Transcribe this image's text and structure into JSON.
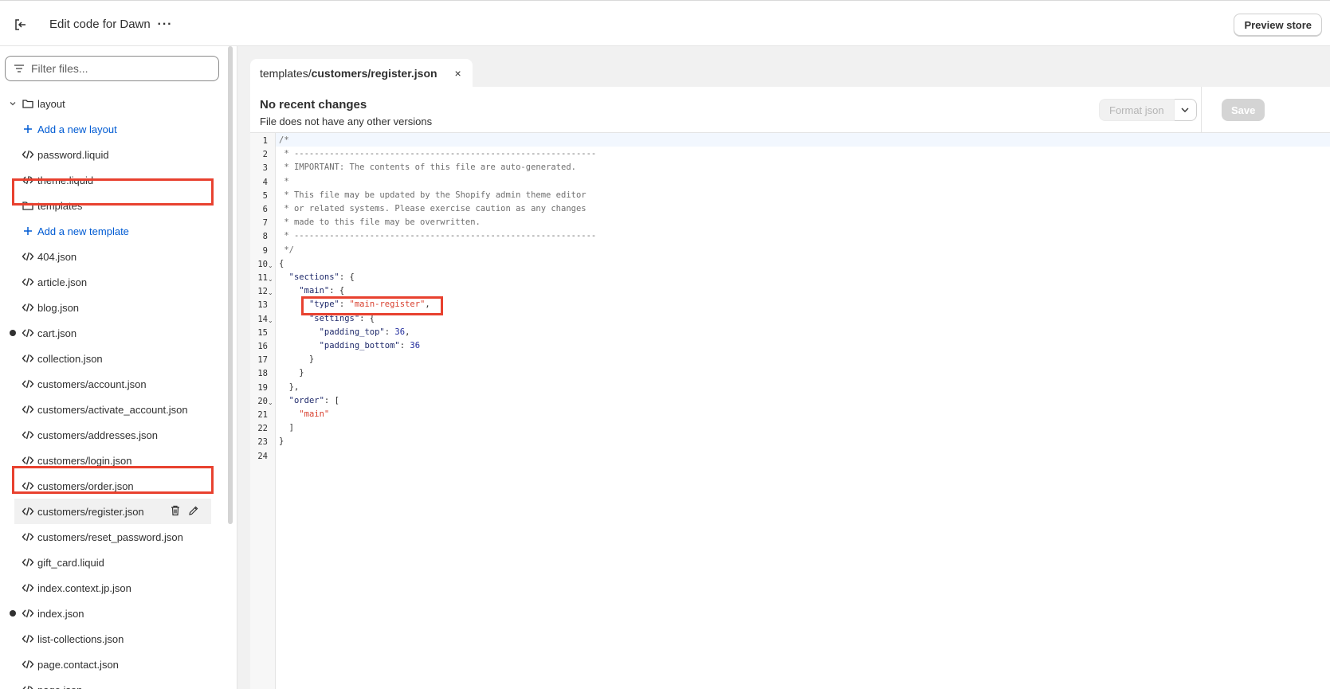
{
  "topbar": {
    "title": "Edit code for Dawn",
    "more_label": "···",
    "preview_label": "Preview store"
  },
  "sidebar": {
    "filter_placeholder": "Filter files...",
    "items": [
      {
        "type": "folder",
        "label": "layout",
        "icon": "folder-icon"
      },
      {
        "type": "add",
        "label": "Add a new layout",
        "icon": "plus-icon"
      },
      {
        "type": "file",
        "label": "password.liquid",
        "icon": "code-icon"
      },
      {
        "type": "file",
        "label": "theme.liquid",
        "icon": "code-icon"
      },
      {
        "type": "folder",
        "label": "templates",
        "icon": "folder-icon"
      },
      {
        "type": "add",
        "label": "Add a new template",
        "icon": "plus-icon"
      },
      {
        "type": "file",
        "label": "404.json",
        "icon": "code-icon"
      },
      {
        "type": "file",
        "label": "article.json",
        "icon": "code-icon"
      },
      {
        "type": "file",
        "label": "blog.json",
        "icon": "code-icon"
      },
      {
        "type": "file",
        "label": "cart.json",
        "icon": "code-icon",
        "modified": true
      },
      {
        "type": "file",
        "label": "collection.json",
        "icon": "code-icon"
      },
      {
        "type": "file",
        "label": "customers/account.json",
        "icon": "code-icon"
      },
      {
        "type": "file",
        "label": "customers/activate_account.json",
        "icon": "code-icon"
      },
      {
        "type": "file",
        "label": "customers/addresses.json",
        "icon": "code-icon"
      },
      {
        "type": "file",
        "label": "customers/login.json",
        "icon": "code-icon"
      },
      {
        "type": "file",
        "label": "customers/order.json",
        "icon": "code-icon"
      },
      {
        "type": "file",
        "label": "customers/register.json",
        "icon": "code-icon",
        "selected": true
      },
      {
        "type": "file",
        "label": "customers/reset_password.json",
        "icon": "code-icon"
      },
      {
        "type": "file",
        "label": "gift_card.liquid",
        "icon": "code-icon"
      },
      {
        "type": "file",
        "label": "index.context.jp.json",
        "icon": "code-icon"
      },
      {
        "type": "file",
        "label": "index.json",
        "icon": "code-icon",
        "modified": true
      },
      {
        "type": "file",
        "label": "list-collections.json",
        "icon": "code-icon"
      },
      {
        "type": "file",
        "label": "page.contact.json",
        "icon": "code-icon"
      },
      {
        "type": "file",
        "label": "page.json",
        "icon": "code-icon"
      }
    ]
  },
  "tab": {
    "path_prefix": "templates/",
    "path_name": "customers/register.json",
    "close_label": "×"
  },
  "status": {
    "title": "No recent changes",
    "subtitle": "File does not have any other versions",
    "format_label": "Format json",
    "save_label": "Save"
  },
  "editor": {
    "line_numbers": [
      "1",
      "2",
      "3",
      "4",
      "5",
      "6",
      "7",
      "8",
      "9",
      "10",
      "11",
      "12",
      "13",
      "14",
      "15",
      "16",
      "17",
      "18",
      "19",
      "20",
      "21",
      "22",
      "23",
      "24"
    ],
    "lines": [
      "/*",
      " * ------------------------------------------------------------",
      " * IMPORTANT: The contents of this file are auto-generated.",
      " *",
      " * This file may be updated by the Shopify admin theme editor",
      " * or related systems. Please exercise caution as any changes",
      " * made to this file may be overwritten.",
      " * ------------------------------------------------------------",
      " */",
      "{",
      "  \"sections\": {",
      "    \"main\": {",
      "      \"type\": \"main-register\",",
      "      \"settings\": {",
      "        \"padding_top\": 36,",
      "        \"padding_bottom\": 36",
      "      }",
      "    }",
      "  },",
      "  \"order\": [",
      "    \"main\"",
      "  ]",
      "}",
      ""
    ]
  },
  "colors": {
    "link": "#005bd3",
    "highlight": "#e8412f",
    "string": "#d8402f",
    "key": "#1f2a6b"
  }
}
